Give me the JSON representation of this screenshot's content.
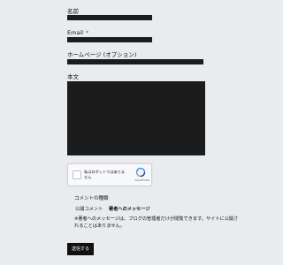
{
  "form": {
    "name": {
      "label": "名前",
      "value": ""
    },
    "email": {
      "label": "Email",
      "required_mark": "*",
      "value": ""
    },
    "website": {
      "label": "ホームページ (オプション)",
      "value": ""
    },
    "body": {
      "label": "本文",
      "value": ""
    }
  },
  "captcha": {
    "label": "私はロボットではありません",
    "brand": "reCAPTCHA",
    "checked": false
  },
  "comment_type": {
    "title": "コメントの種類",
    "options": [
      {
        "label": "公開コメント",
        "selected": false
      },
      {
        "label": "著者へのメッセージ",
        "selected": true
      }
    ],
    "note": "※著者へのメッセージは、ブログの管理者だけが閲覧できます。サイトに公開されることはありません。"
  },
  "submit_label": "送信する",
  "colors": {
    "page_bg": "#e9ecef",
    "field_bg": "#1c1c1c",
    "required": "#d21f3c",
    "submit_bg": "#111111"
  }
}
